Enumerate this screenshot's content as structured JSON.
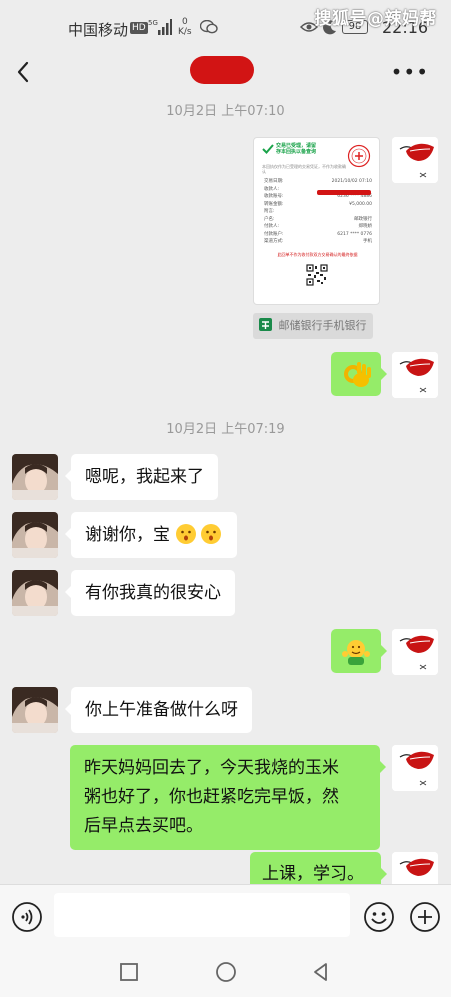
{
  "status_bar": {
    "carrier": "中国移动",
    "network_badge": "HD",
    "signal": "5G",
    "speed_value": "0",
    "speed_unit": "K/s",
    "battery": "98",
    "time": "22:16",
    "watermark": "搜狐号@辣妈帮"
  },
  "header": {
    "more_label": "•••"
  },
  "messages": {
    "timestamp_1": "10月2日 上午07:10",
    "receipt": {
      "title_line1": "交易已受理，请留",
      "title_line2": "存本回执以备查询",
      "note": "本回执仅作为已受理的交易凭证，不作为收款确认",
      "row_labels": [
        "交易日期:",
        "收款人:",
        "收款账号:",
        "转账金额:",
        "附言:",
        "户名:",
        "付款人:",
        "付款账户:",
        "渠道方式:"
      ],
      "row_values": [
        "2021/10/02 07:10",
        "",
        "6236 **** 4886",
        "¥5,000.00",
        "",
        "邮政银行",
        "郑晓娇",
        "6217 **** 0776",
        "手机"
      ],
      "footer_note": "此回单不作为收付款双方交易确认的最终依据"
    },
    "source_tag": "邮储银行手机银行",
    "timestamp_2": "10月2日 上午07:19",
    "msg_1": "嗯呢，我起来了",
    "msg_2": "谢谢你，宝",
    "msg_3": "有你我真的很安心",
    "msg_4": "你上午准备做什么呀",
    "msg_5_line1": "昨天妈妈回去了，今天我烧的玉米",
    "msg_5_line2": "粥也好了，你也赶紧吃完早饭，然",
    "msg_5_line3": "后早点去买吧。",
    "msg_6": "上课，学习。"
  },
  "input": {
    "value": ""
  },
  "colors": {
    "bubble_self": "#95ec69",
    "bubble_other": "#ffffff",
    "background": "#ededed",
    "redaction": "#d21414"
  }
}
